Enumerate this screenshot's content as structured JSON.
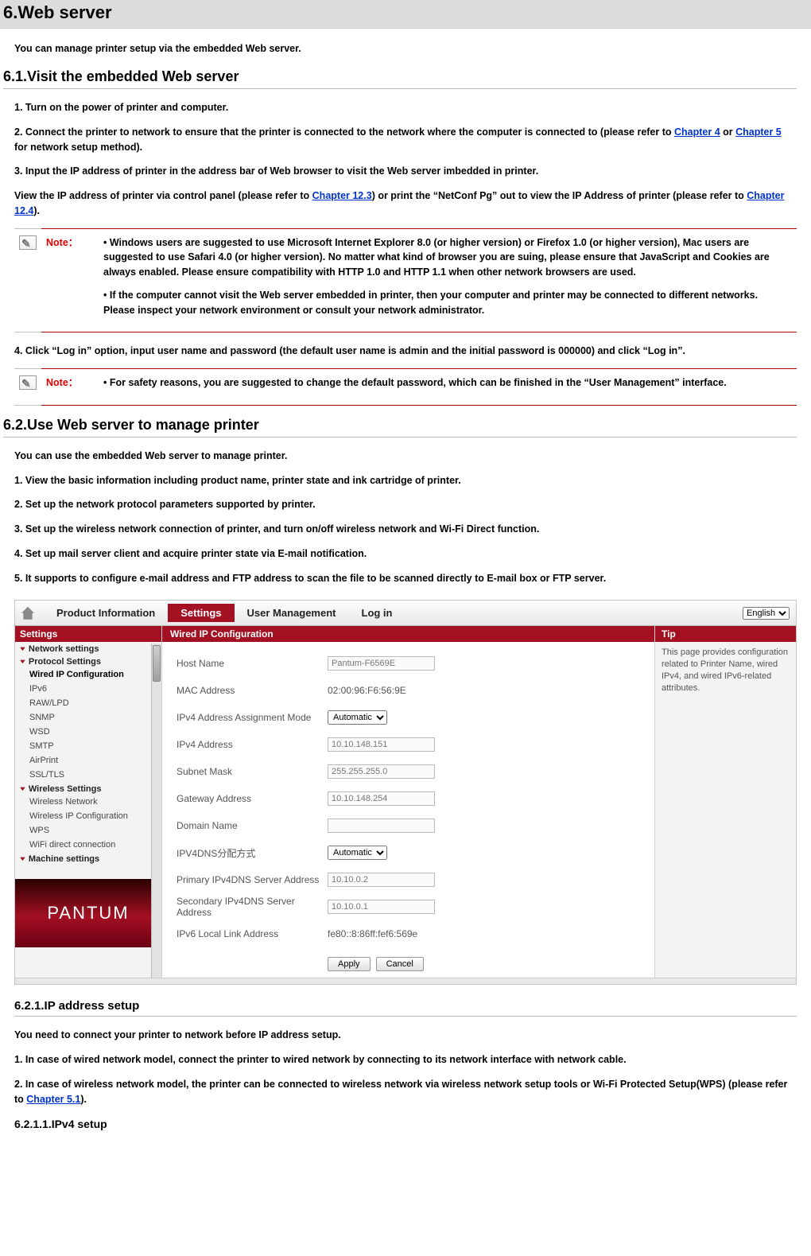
{
  "page_title": "6.Web server",
  "intro": "You can manage printer setup via the embedded Web server.",
  "sec61": {
    "heading": "6.1.Visit the embedded Web server",
    "p1": "1. Turn on the power of printer and computer.",
    "p2a": "2. Connect the printer to network to ensure that the printer is connected to the network where the computer is connected to (please refer to ",
    "p2l1": "Chapter 4",
    "p2m": " or ",
    "p2l2": "Chapter 5",
    "p2b": " for network setup method).",
    "p3": "3. Input the IP address of printer in the address bar of Web browser to visit the Web server imbedded in printer.",
    "p4a": "View the IP address of printer via control panel (please refer to ",
    "p4l1": "Chapter 12.3",
    "p4m": ") or print the “NetConf Pg” out to view the IP Address of printer (please refer to ",
    "p4l2": "Chapter 12.4",
    "p4b": ").",
    "note1": {
      "label": "Note：",
      "b1": "• Windows users are suggested to use Microsoft Internet Explorer 8.0 (or higher version) or Firefox 1.0 (or higher version), Mac users are suggested to use Safari 4.0 (or higher version). No matter what kind of browser you are suing, please ensure that JavaScript and Cookies are always enabled. Please ensure compatibility with HTTP 1.0 and HTTP 1.1 when other network browsers are used.",
      "b2": "• If the computer cannot visit the Web server embedded in printer, then your computer and printer may be connected to different networks. Please inspect your network environment or consult your network administrator."
    },
    "p5": "4. Click “Log in” option, input user name and password (the default user name is admin and the initial password is 000000) and click “Log in”.",
    "note2": {
      "label": "Note：",
      "b1": "• For safety reasons, you are suggested to change the default password, which can be finished in the “User Management” interface."
    }
  },
  "sec62": {
    "heading": "6.2.Use Web server to manage printer",
    "p0": "You can use the embedded Web server to manage printer.",
    "p1": "1. View the basic information including product name, printer state and ink cartridge of printer.",
    "p2": "2. Set up the network protocol parameters supported by printer.",
    "p3": "3. Set up the wireless network connection of printer, and turn on/off wireless network and Wi-Fi Direct function.",
    "p4": "4. Set up mail server client and acquire printer state via E-mail notification.",
    "p5": "5. It supports to configure e-mail address and FTP address to scan the file to be scanned directly to E-mail box or FTP server."
  },
  "webui": {
    "tabs": [
      "Product Information",
      "Settings",
      "User Management",
      "Log in"
    ],
    "activeTab": "Settings",
    "langLabel": "English",
    "sidebar": {
      "title": "Settings",
      "groups": [
        {
          "label": "Network settings",
          "items": []
        },
        {
          "label": "Protocol Settings",
          "items": [
            "Wired IP Configuration",
            "IPv6",
            "RAW/LPD",
            "SNMP",
            "WSD",
            "SMTP",
            "AirPrint",
            "SSL/TLS"
          ],
          "selected": "Wired IP Configuration"
        },
        {
          "label": "Wireless Settings",
          "items": [
            "Wireless Network",
            "Wireless IP Configuration",
            "WPS",
            "WiFi direct connection"
          ]
        },
        {
          "label": "Machine settings",
          "items": []
        }
      ],
      "brand": "PANTUM"
    },
    "panel": {
      "title": "Wired IP Configuration",
      "rows": [
        {
          "label": "Host Name",
          "type": "text",
          "value": "Pantum-F6569E"
        },
        {
          "label": "MAC Address",
          "type": "static",
          "value": "02:00:96:F6:56:9E"
        },
        {
          "label": "IPv4 Address Assignment Mode",
          "type": "select",
          "value": "Automatic"
        },
        {
          "label": "IPv4 Address",
          "type": "text",
          "value": "10.10.148.151"
        },
        {
          "label": "Subnet Mask",
          "type": "text",
          "value": "255.255.255.0"
        },
        {
          "label": "Gateway Address",
          "type": "text",
          "value": "10.10.148.254"
        },
        {
          "label": "Domain Name",
          "type": "text",
          "value": ""
        },
        {
          "label": "IPV4DNS分配方式",
          "type": "select",
          "value": "Automatic"
        },
        {
          "label": "Primary IPv4DNS Server Address",
          "type": "text",
          "value": "10.10.0.2"
        },
        {
          "label": "Secondary IPv4DNS Server Address",
          "type": "text",
          "value": "10.10.0.1"
        },
        {
          "label": "IPv6 Local Link Address",
          "type": "static",
          "value": "fe80::8:86ff:fef6:569e"
        }
      ],
      "buttons": {
        "apply": "Apply",
        "cancel": "Cancel"
      }
    },
    "tip": {
      "title": "Tip",
      "body": "This page provides configuration related to Printer Name, wired IPv4, and wired IPv6-related attributes."
    }
  },
  "sec621": {
    "heading": "6.2.1.IP address setup",
    "p0": "You need to connect your printer to network before IP address setup.",
    "p1": "1. In case of wired network model, connect the printer to wired network by connecting to its network interface with network cable.",
    "p2a": "2. In case of wireless network model, the printer can be connected to wireless network via wireless network setup tools or Wi-Fi Protected Setup(WPS) (please refer to ",
    "p2l": "Chapter 5.1",
    "p2b": ")."
  },
  "sec6211": {
    "heading": "6.2.1.1.IPv4 setup"
  }
}
